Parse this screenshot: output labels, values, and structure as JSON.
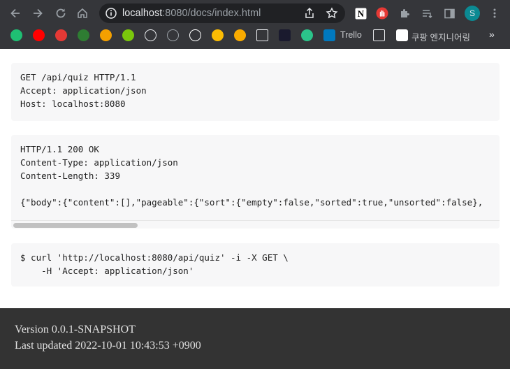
{
  "browser": {
    "url_host": "localhost",
    "url_rest": ":8080/docs/index.html",
    "avatar_letter": "S",
    "bookmarks": [
      {
        "icon": "green-circle-icon",
        "color": "#1fbf73",
        "label": ""
      },
      {
        "icon": "youtube-icon",
        "color": "#ff0000",
        "label": ""
      },
      {
        "icon": "red-c-icon",
        "color": "#e53935",
        "label": ""
      },
      {
        "icon": "green-clock-icon",
        "color": "#2e7d32",
        "label": ""
      },
      {
        "icon": "orange-layers-icon",
        "color": "#f4a000",
        "label": ""
      },
      {
        "icon": "duolingo-icon",
        "color": "#7ac70c",
        "label": ""
      },
      {
        "icon": "speedometer-icon",
        "color": "#e8eaed",
        "label": ""
      },
      {
        "icon": "tree-icon",
        "color": "#9aa0a6",
        "label": ""
      },
      {
        "icon": "github-icon",
        "color": "#ffffff",
        "label": ""
      },
      {
        "icon": "google-ads-icon",
        "color": "#fbbc04",
        "label": ""
      },
      {
        "icon": "analytics-icon",
        "color": "#f9ab00",
        "label": ""
      },
      {
        "icon": "store-icon",
        "color": "#e8eaed",
        "label": ""
      },
      {
        "icon": "plane-icon",
        "color": "#1a1a2e",
        "label": ""
      },
      {
        "icon": "d2-icon",
        "color": "#2bc48a",
        "label": ""
      },
      {
        "icon": "trello-icon",
        "color": "#0079bf",
        "label": "Trello"
      },
      {
        "icon": "folder-icon",
        "color": "#e8eaed",
        "label": ""
      },
      {
        "icon": "medium-icon",
        "color": "#ffffff",
        "label": "쿠팡 엔지니어링"
      }
    ],
    "bookmarks_more": "»"
  },
  "docs": {
    "request_block": "GET /api/quiz HTTP/1.1\nAccept: application/json\nHost: localhost:8080",
    "response_block": "HTTP/1.1 200 OK\nContent-Type: application/json\nContent-Length: 339\n\n{\"body\":{\"content\":[],\"pageable\":{\"sort\":{\"empty\":false,\"sorted\":true,\"unsorted\":false},",
    "curl_block": "$ curl 'http://localhost:8080/api/quiz' -i -X GET \\\n    -H 'Accept: application/json'"
  },
  "footer": {
    "version": "Version 0.0.1-SNAPSHOT",
    "last_updated": "Last updated 2022-10-01 10:43:53 +0900"
  }
}
